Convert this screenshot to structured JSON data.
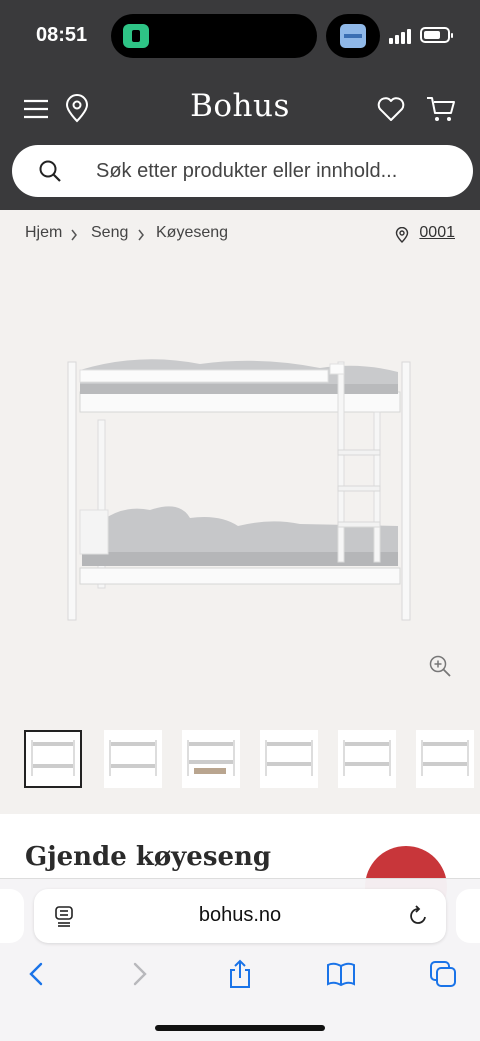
{
  "status_bar": {
    "time": "08:51"
  },
  "header": {
    "logo": "Bohus"
  },
  "search": {
    "placeholder": "Søk etter produkter eller innhold..."
  },
  "breadcrumb": {
    "items": [
      "Hjem",
      "Seng",
      "Køyeseng"
    ],
    "store_code": "0001"
  },
  "gallery": {
    "thumbnail_count": 6,
    "active_index": 0
  },
  "product": {
    "title": "Gjende køyeseng"
  },
  "browser": {
    "url": "bohus.no"
  },
  "colors": {
    "header_bg": "#3a3a3c",
    "page_bg": "#f3f1ef",
    "badge_red": "#c8363a",
    "browser_blue": "#1a73e8"
  },
  "icons": [
    "menu-icon",
    "location-pin-icon",
    "heart-icon",
    "cart-icon",
    "search-icon",
    "zoom-in-icon",
    "reader-icon",
    "reload-icon",
    "back-icon",
    "forward-icon",
    "share-icon",
    "bookmarks-icon",
    "tabs-icon"
  ]
}
